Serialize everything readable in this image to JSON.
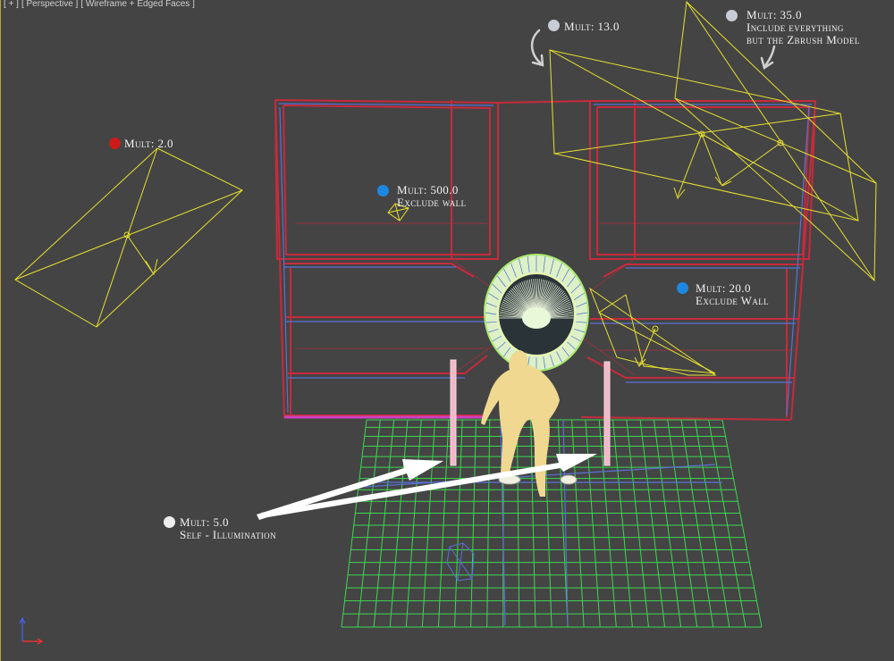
{
  "viewport": {
    "label_parts": [
      "[ + ]",
      "[ Perspective ]",
      "[ Wireframe + Edged Faces ]"
    ]
  },
  "colors": {
    "background": "#444444",
    "light_gizmo": "#e8e030",
    "wall_wire": "#c82a3c",
    "wall_edge": "#5a70d8",
    "floor_wire": "#3cd850",
    "character": "#f0d890",
    "arrow": "#ffffff",
    "dot_red": "#cc1a1a",
    "dot_blue": "#1e88e0",
    "dot_gray": "#c8ccd4",
    "dot_white": "#eeeeee"
  },
  "annotations": [
    {
      "id": "light-13",
      "lines": [
        "Mult: 13.0"
      ],
      "dot": "dot_gray"
    },
    {
      "id": "light-35",
      "lines": [
        "Mult: 35.0",
        "Include everything",
        "but the Zbrush Model"
      ],
      "dot": "dot_gray"
    },
    {
      "id": "light-2",
      "lines": [
        "Mult: 2.0"
      ],
      "dot": "dot_red"
    },
    {
      "id": "light-500",
      "lines": [
        "Mult: 500.0",
        "Exclude wall"
      ],
      "dot": "dot_blue"
    },
    {
      "id": "light-20",
      "lines": [
        "Mult: 20.0",
        "Exclude Wall"
      ],
      "dot": "dot_blue"
    },
    {
      "id": "light-5",
      "lines": [
        "Mult: 5.0",
        "Self - Illumination"
      ],
      "dot": "dot_white"
    }
  ],
  "axis_gizmo": {
    "icon": "axis-tripod-icon"
  }
}
